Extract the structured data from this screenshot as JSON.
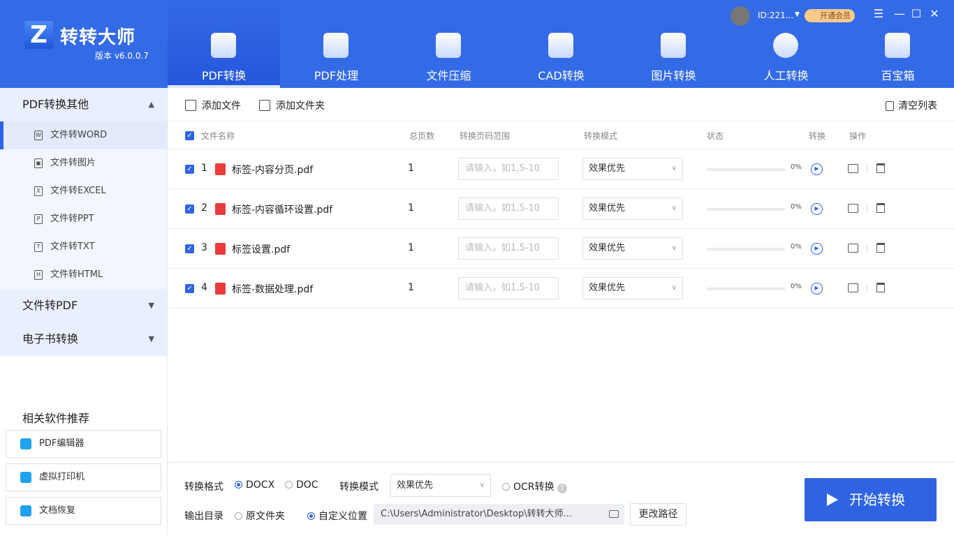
{
  "app": {
    "logo_letter": "Z",
    "name": "转转大师",
    "version": "版本 v6.0.0.7"
  },
  "tabs": [
    {
      "label": "PDF转换"
    },
    {
      "label": "PDF处理"
    },
    {
      "label": "文件压缩"
    },
    {
      "label": "CAD转换"
    },
    {
      "label": "图片转换"
    },
    {
      "label": "人工转换"
    },
    {
      "label": "百宝箱"
    }
  ],
  "user": {
    "id": "ID:221...",
    "vip": "开通会员"
  },
  "window": {
    "menu": "☰",
    "minimize": "—",
    "maximize": "☐",
    "close": "✕"
  },
  "sidebar": {
    "groups": [
      {
        "label": "PDF转换其他",
        "arrow": "▲"
      },
      {
        "label": "文件转PDF",
        "arrow": "▼"
      },
      {
        "label": "电子书转换",
        "arrow": "▼"
      }
    ],
    "items": [
      {
        "label": "文件转WORD",
        "glyph": "W"
      },
      {
        "label": "文件转图片",
        "glyph": "▣"
      },
      {
        "label": "文件转EXCEL",
        "glyph": "X"
      },
      {
        "label": "文件转PPT",
        "glyph": "P"
      },
      {
        "label": "文件转TXT",
        "glyph": "T"
      },
      {
        "label": "文件转HTML",
        "glyph": "H"
      }
    ],
    "recommend_title": "相关软件推荐",
    "recommend": [
      {
        "label": "PDF编辑器"
      },
      {
        "label": "虚拟打印机"
      },
      {
        "label": "文档恢复"
      }
    ]
  },
  "toolbar": {
    "add_file": "添加文件",
    "add_folder": "添加文件夹",
    "clear": "清空列表"
  },
  "table": {
    "headers": {
      "name": "文件名称",
      "pages": "总页数",
      "range": "转换页码范围",
      "mode": "转换模式",
      "status": "状态",
      "convert": "转换",
      "ops": "操作"
    },
    "range_placeholder": "请输入，如1,5-10",
    "rows": [
      {
        "num": "1",
        "name": "标签-内容分页.pdf",
        "pages": "1",
        "mode": "效果优先",
        "progress": 0,
        "pct": "0%"
      },
      {
        "num": "2",
        "name": "标签-内容循环设置.pdf",
        "pages": "1",
        "mode": "效果优先",
        "progress": 0,
        "pct": "0%"
      },
      {
        "num": "3",
        "name": "标签设置.pdf",
        "pages": "1",
        "mode": "效果优先",
        "progress": 0,
        "pct": "0%"
      },
      {
        "num": "4",
        "name": "标签-数据处理.pdf",
        "pages": "1",
        "mode": "效果优先",
        "progress": 0,
        "pct": "0%"
      }
    ]
  },
  "bottom": {
    "format_label": "转换格式",
    "docx": "DOCX",
    "doc": "DOC",
    "mode_label": "转换模式",
    "mode_value": "效果优先",
    "ocr": "OCR转换",
    "help": "?",
    "output_label": "输出目录",
    "original": "原文件夹",
    "custom": "自定义位置",
    "path": "C:\\Users\\Administrator\\Desktop\\转转大师...",
    "change": "更改路径",
    "start": "开始转换"
  }
}
